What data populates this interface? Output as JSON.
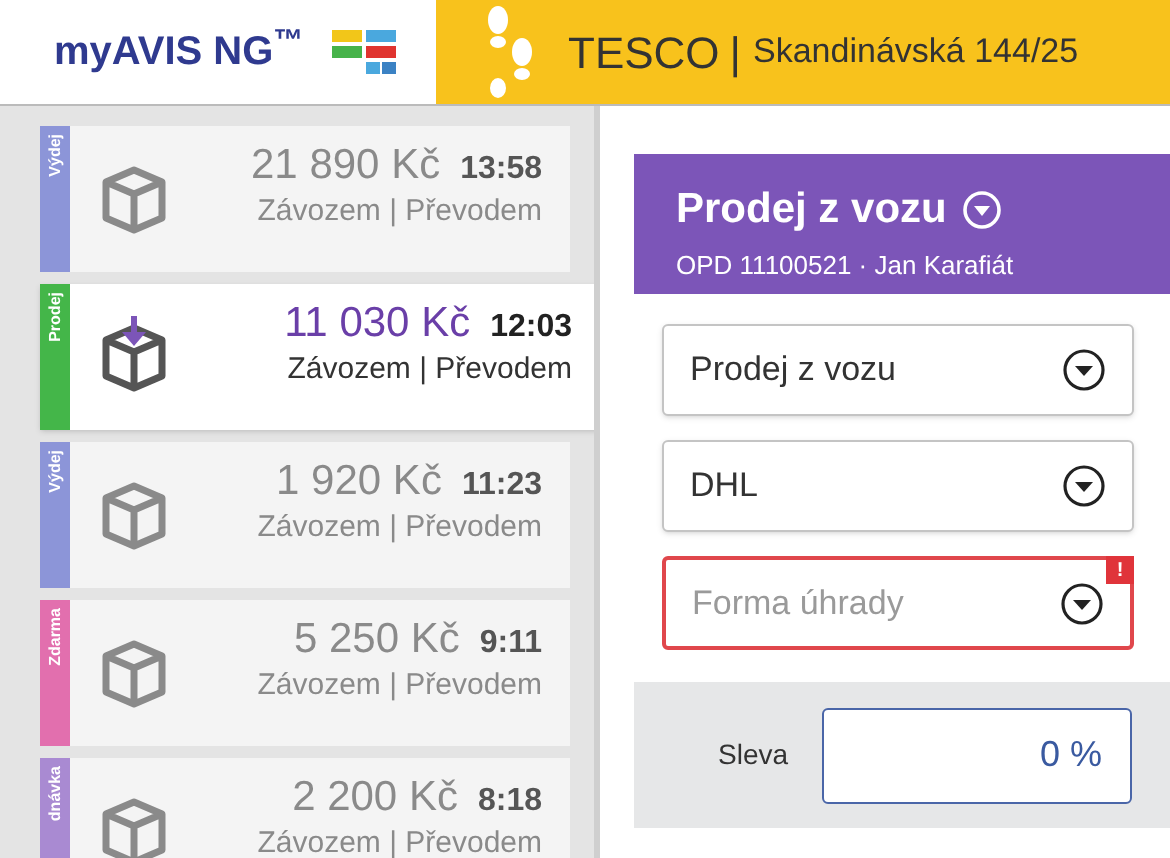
{
  "header": {
    "logo": "myAVIS NG$^{™}$",
    "store": "TESCO",
    "separator": "|",
    "address": "Skandinávská 144/25"
  },
  "orders": [
    {
      "tag": "Výdej",
      "color": "#8c95d8",
      "amount": "21 890 Kč",
      "time": "13:58",
      "details": "Závozem | Převodem",
      "selected": false
    },
    {
      "tag": "Prodej",
      "color": "#44b649",
      "amount": "11 030 Kč",
      "time": "12:03",
      "details": "Závozem | Převodem",
      "selected": true
    },
    {
      "tag": "Výdej",
      "color": "#8c95d8",
      "amount": "1 920 Kč",
      "time": "11:23",
      "details": "Závozem | Převodem",
      "selected": false
    },
    {
      "tag": "Zdarma",
      "color": "#e26fae",
      "amount": "5 250 Kč",
      "time": "9:11",
      "details": "Závozem | Převodem",
      "selected": false
    },
    {
      "tag": "dnávka",
      "color": "#a98ad2",
      "amount": "2 200 Kč",
      "time": "8:18",
      "details": "Závozem | Převodem",
      "selected": false
    }
  ],
  "detail": {
    "title": "Prodej z vozu",
    "subtitle": "OPD 11100521 · Jan Karafiát",
    "fields": [
      {
        "value": "Prodej z vozu",
        "error": false
      },
      {
        "value": "DHL",
        "error": false
      },
      {
        "placeholder": "Forma úhrady",
        "error": true,
        "error_mark": "!"
      }
    ],
    "discount": {
      "label": "Sleva",
      "value": "0 %"
    }
  }
}
